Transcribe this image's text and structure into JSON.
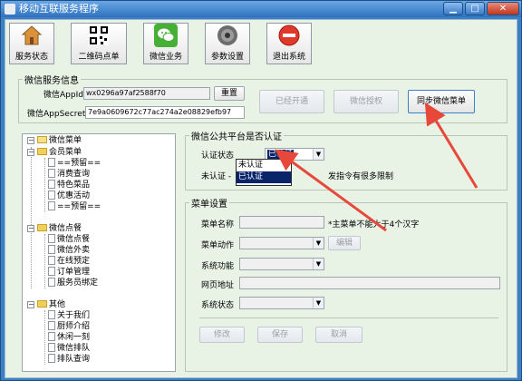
{
  "window": {
    "title": "移动互联服务程序",
    "min": "▁",
    "max": "□",
    "close": "✕"
  },
  "toolbar": [
    {
      "label": "服务状态",
      "icon": "house-icon"
    },
    {
      "label": "二维码点单",
      "icon": "qrcode-icon"
    },
    {
      "label": "微信业务",
      "icon": "wechat-icon"
    },
    {
      "label": "参数设置",
      "icon": "settings-disc-icon"
    },
    {
      "label": "退出系统",
      "icon": "exit-icon"
    }
  ],
  "wechat_info": {
    "legend": "微信服务信息",
    "appid_label": "微信AppId",
    "appid_value": "wx0296a97af2588f70",
    "secret_label": "微信AppSecret",
    "secret_value": "7e9a0609672c77ac274a2e08829efb97",
    "reset_button": "重置",
    "opened_button": "已经开通",
    "authorize_button": "微信授权",
    "sync_button": "同步微信菜单"
  },
  "tree": {
    "root": "微信菜单",
    "groups": [
      {
        "label": "会员菜单",
        "items": [
          "==预留==",
          "消费查询",
          "特色菜品",
          "优惠活动",
          "==预留=="
        ]
      },
      {
        "label": "微信点餐",
        "items": [
          "微信点餐",
          "微信外卖",
          "在线预定",
          "订单管理",
          "服务员绑定"
        ]
      },
      {
        "label": "其他",
        "items": [
          "关于我们",
          "厨师介绍",
          "休闲一刻",
          "微信排队",
          "排队查询"
        ]
      }
    ]
  },
  "auth": {
    "legend": "微信公共平台是否认证",
    "status_label": "认证状态",
    "status_value": "已认证",
    "options": [
      "未认证",
      "已认证"
    ],
    "note_prefix": "未认证 -",
    "note_suffix": "发指令有很多限制"
  },
  "menu_settings": {
    "legend": "菜单设置",
    "name_label": "菜单名称",
    "name_note": "*主菜单不能大于4个汉字",
    "action_label": "菜单动作",
    "edit_button": "编辑",
    "func_label": "系统功能",
    "url_label": "网页地址",
    "status_label": "系统状态",
    "modify_button": "修改",
    "save_button": "保存",
    "cancel_button": "取消"
  },
  "colors": {
    "titlebar": "#2f72bd",
    "client_bg": "#e8f3e6",
    "arrow": "#e8483a",
    "selection": "#0a246a"
  }
}
